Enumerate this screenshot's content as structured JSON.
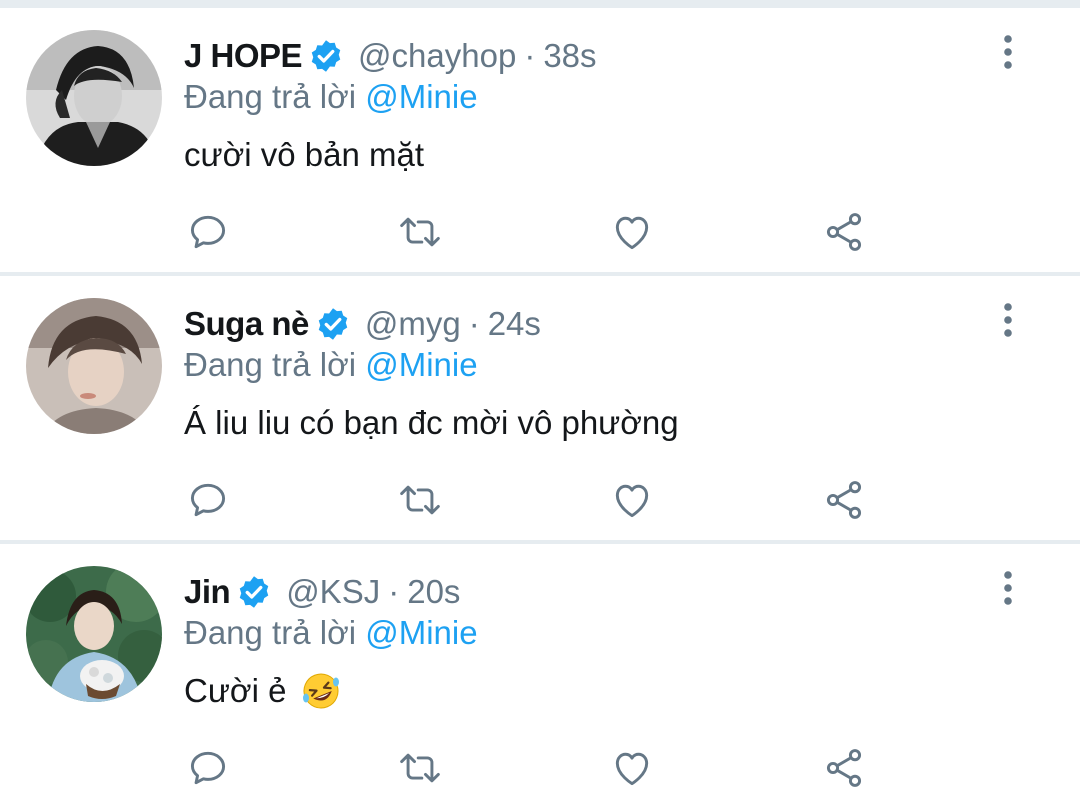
{
  "colors": {
    "accent": "#1da1f2",
    "text": "#14171a",
    "muted": "#657786",
    "divider": "#e6ecf0"
  },
  "icons": {
    "verified": "verified-badge-icon",
    "more": "more-vertical-icon",
    "reply": "reply-icon",
    "retweet": "retweet-icon",
    "like": "heart-icon",
    "share": "share-icon"
  },
  "tweets": [
    {
      "name": "J HOPE",
      "verified": true,
      "handle": "@chayhop",
      "separator": "·",
      "time": "38s",
      "reply_prefix": "Đang trả lời",
      "reply_to": "@Minie",
      "text": "cười vô bản mặt",
      "emoji": ""
    },
    {
      "name": "Suga nè",
      "verified": true,
      "handle": "@myg",
      "separator": "·",
      "time": "24s",
      "reply_prefix": "Đang trả lời",
      "reply_to": "@Minie",
      "text": "Á liu liu có bạn đc mời vô phường",
      "emoji": ""
    },
    {
      "name": "Jin",
      "verified": true,
      "handle": "@KSJ",
      "separator": "·",
      "time": "20s",
      "reply_prefix": "Đang trả lời",
      "reply_to": "@Minie",
      "text": "Cười ẻ",
      "emoji": "rolling-on-floor-laughing"
    }
  ]
}
